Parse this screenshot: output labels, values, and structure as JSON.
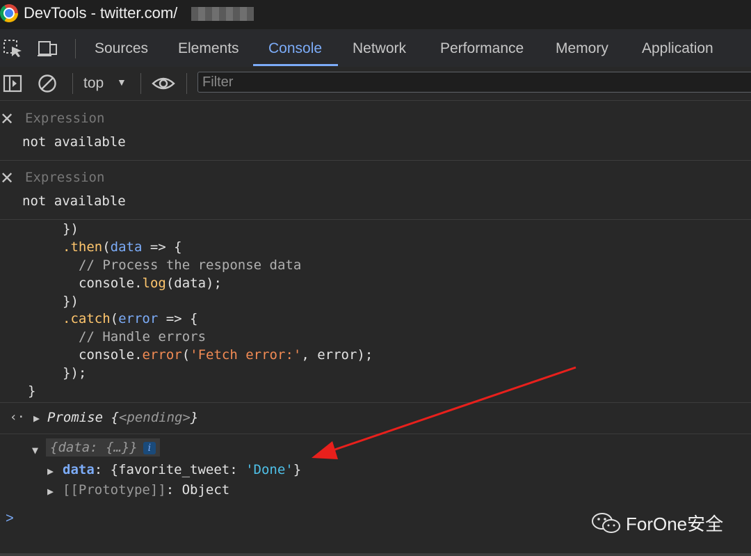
{
  "window": {
    "title": "DevTools - twitter.com/"
  },
  "tabs": [
    {
      "label": "Sources"
    },
    {
      "label": "Elements"
    },
    {
      "label": "Console"
    },
    {
      "label": "Network"
    },
    {
      "label": "Performance"
    },
    {
      "label": "Memory"
    },
    {
      "label": "Application"
    }
  ],
  "toolbar": {
    "context": "top",
    "filter_placeholder": "Filter"
  },
  "expressions": [
    {
      "label": "Expression",
      "value": "not available"
    },
    {
      "label": "Expression",
      "value": "not available"
    }
  ],
  "code": {
    "l1": "})",
    "l2_then": ".then",
    "l2_open": "(",
    "l2_param": "data",
    "l2_rest": " => {",
    "l3": "// Process the response data",
    "l4_obj": "console.",
    "l4_fn": "log",
    "l4_rest": "(data);",
    "l5": "})",
    "l6_catch": ".catch",
    "l6_open": "(",
    "l6_param": "error",
    "l6_rest": " => {",
    "l7": "// Handle errors",
    "l8_obj": "console.",
    "l8_fn": "error",
    "l8_open": "(",
    "l8_str": "'Fetch error:'",
    "l8_rest": ", error);",
    "l9": "});",
    "l10": "}"
  },
  "promise": {
    "label": "Promise",
    "open": " {",
    "state": "<pending>",
    "close": "}"
  },
  "object": {
    "head": "{data: {…}}",
    "info": "i",
    "data_key": "data",
    "data_open": ": {favorite_tweet: ",
    "data_str": "'Done'",
    "data_close": "}",
    "proto_key": "[[Prototype]]",
    "proto_val": ": Object"
  },
  "prompt": ">",
  "watermark": "ForOne安全",
  "colors": {
    "accent": "#7cacf8",
    "arrow": "#e8201c"
  }
}
